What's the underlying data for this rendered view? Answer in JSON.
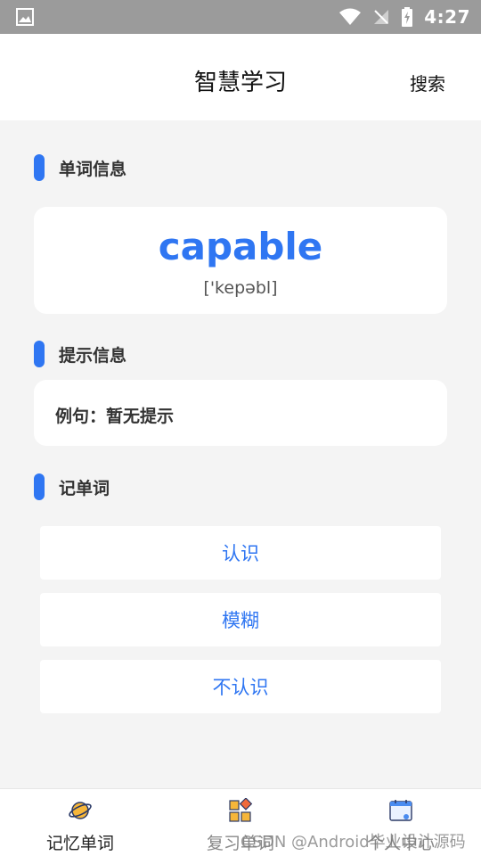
{
  "status_bar": {
    "time": "4:27"
  },
  "app_bar": {
    "title": "智慧学习",
    "search_label": "搜索"
  },
  "sections": {
    "word_info": "单词信息",
    "hint_info": "提示信息",
    "memorize": "记单词"
  },
  "word": {
    "text": "capable",
    "phonetic": "['kepəbl]"
  },
  "hint": {
    "text": "例句：暂无提示"
  },
  "choices": [
    "认识",
    "模糊",
    "不认识"
  ],
  "bottom_nav": [
    {
      "label": "记忆单词",
      "icon": "planet-icon"
    },
    {
      "label": "复习单词",
      "icon": "grid-icon"
    },
    {
      "label": "个人中心",
      "icon": "calendar-icon"
    }
  ],
  "watermark": "CSDN @Android毕业设计源码",
  "colors": {
    "accent": "#2f76f2",
    "status_bar": "#9b9b9b",
    "background": "#f4f4f4"
  }
}
